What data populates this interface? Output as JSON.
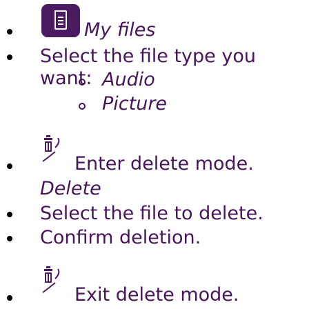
{
  "colors": {
    "text": "#46155a",
    "icon_bg": "#4b1a60",
    "bullet": "#000000"
  },
  "items": {
    "my_files": {
      "label": "My files",
      "icon": "my-files-icon"
    },
    "select_type": {
      "label": "Select the file type you want:"
    },
    "file_types": [
      "Audio",
      "Picture"
    ],
    "enter_delete": {
      "label": "Enter delete mode.",
      "icon": "trash-check-icon"
    },
    "delete_label": "Delete",
    "select_file": {
      "label": "Select the file to delete."
    },
    "confirm": {
      "label": "Confirm deletion."
    },
    "exit_delete": {
      "label": "Exit delete mode.",
      "icon": "trash-check-icon"
    }
  }
}
